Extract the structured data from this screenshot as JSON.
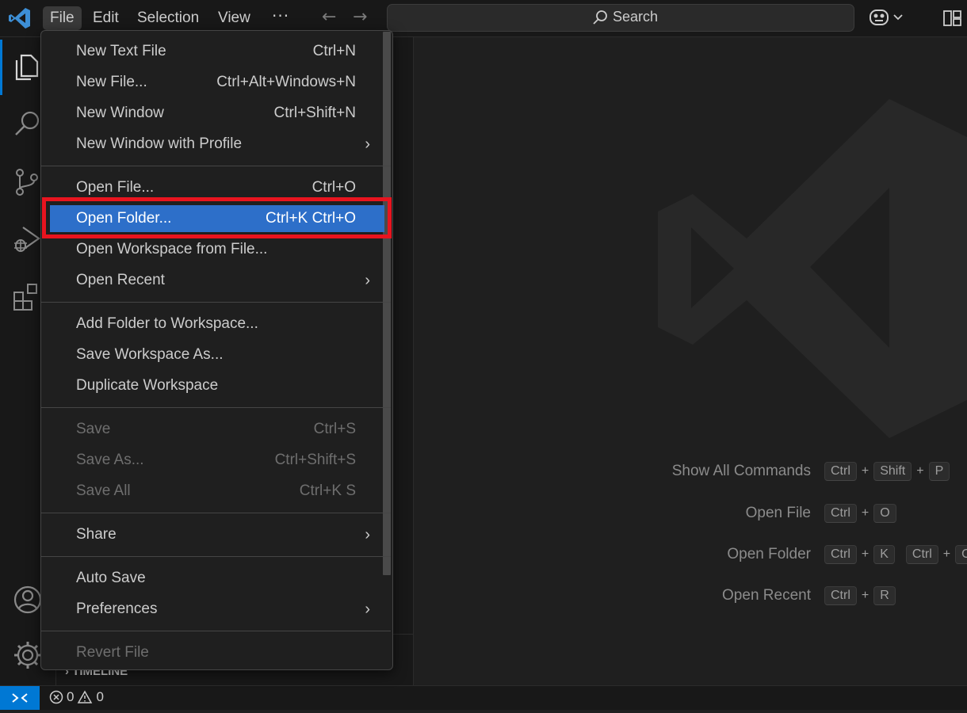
{
  "titlebar": {
    "menus": [
      "File",
      "Edit",
      "Selection",
      "View"
    ],
    "more": "···",
    "search_label": "Search"
  },
  "sidebar": {
    "timeline_label": "TIMELINE"
  },
  "file_menu": {
    "groups": [
      [
        {
          "label": "New Text File",
          "shortcut": "Ctrl+N"
        },
        {
          "label": "New File...",
          "shortcut": "Ctrl+Alt+Windows+N"
        },
        {
          "label": "New Window",
          "shortcut": "Ctrl+Shift+N"
        },
        {
          "label": "New Window with Profile",
          "submenu": true
        }
      ],
      [
        {
          "label": "Open File...",
          "shortcut": "Ctrl+O"
        },
        {
          "label": "Open Folder...",
          "shortcut": "Ctrl+K Ctrl+O",
          "highlighted": true
        },
        {
          "label": "Open Workspace from File..."
        },
        {
          "label": "Open Recent",
          "submenu": true
        }
      ],
      [
        {
          "label": "Add Folder to Workspace..."
        },
        {
          "label": "Save Workspace As..."
        },
        {
          "label": "Duplicate Workspace"
        }
      ],
      [
        {
          "label": "Save",
          "shortcut": "Ctrl+S",
          "disabled": true
        },
        {
          "label": "Save As...",
          "shortcut": "Ctrl+Shift+S",
          "disabled": true
        },
        {
          "label": "Save All",
          "shortcut": "Ctrl+K S",
          "disabled": true
        }
      ],
      [
        {
          "label": "Share",
          "submenu": true
        }
      ],
      [
        {
          "label": "Auto Save"
        },
        {
          "label": "Preferences",
          "submenu": true
        }
      ],
      [
        {
          "label": "Revert File",
          "disabled": true
        }
      ]
    ]
  },
  "editor": {
    "shortcuts": [
      {
        "label": "Show All Commands",
        "keys": [
          [
            "Ctrl",
            "Shift",
            "P"
          ]
        ]
      },
      {
        "label": "Open File",
        "keys": [
          [
            "Ctrl",
            "O"
          ]
        ]
      },
      {
        "label": "Open Folder",
        "keys": [
          [
            "Ctrl",
            "K"
          ],
          [
            "Ctrl",
            "O"
          ]
        ]
      },
      {
        "label": "Open Recent",
        "keys": [
          [
            "Ctrl",
            "R"
          ]
        ]
      }
    ]
  },
  "statusbar": {
    "errors": "0",
    "warnings": "0"
  },
  "colors": {
    "accent": "#0078d4",
    "menu_highlight": "#2d6fc9",
    "annotation_box": "#e8141f"
  }
}
